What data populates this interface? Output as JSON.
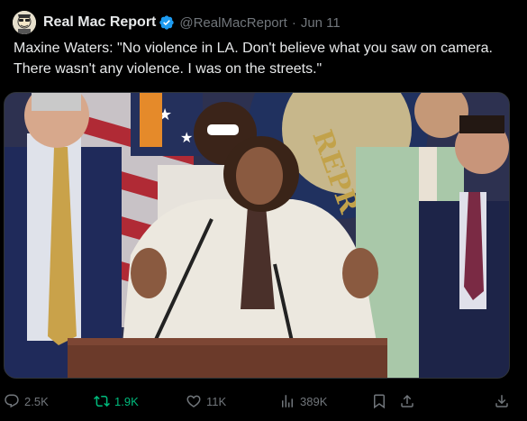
{
  "tweet": {
    "author": {
      "display_name": "Real Mac Report",
      "handle": "@RealMacReport",
      "separator": "·",
      "time": "Jun 11",
      "verified": true
    },
    "text": "Maxine Waters: \"No violence in LA. Don't believe what you saw on camera. There wasn't any violence. I was on the streets.\"",
    "media": {
      "type": "video-frame",
      "icon": "video-thumbnail"
    },
    "actions": {
      "replies": "2.5K",
      "reposts": "1.9K",
      "likes": "11K",
      "views": "389K"
    },
    "colors": {
      "background": "#000000",
      "text": "#e7e9ea",
      "muted": "#71767b",
      "verified": "#1d9bf0",
      "repost_active": "#00ba7c"
    },
    "icons": [
      "reply-icon",
      "repost-icon",
      "like-icon",
      "views-icon",
      "bookmark-icon",
      "share-icon",
      "download-icon",
      "verified-badge-icon"
    ]
  }
}
